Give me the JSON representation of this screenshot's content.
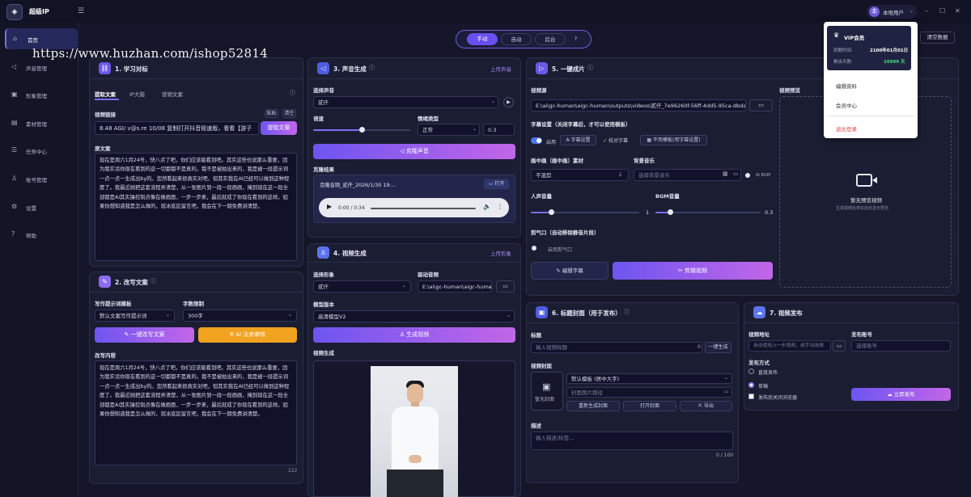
{
  "app": {
    "title": "超级IP",
    "user": "本地用户",
    "avatar": "本"
  },
  "window": {
    "minimize": "–",
    "maximize": "☐",
    "close": "✕",
    "menu": "☰"
  },
  "sidebar": {
    "items": [
      {
        "label": "首页",
        "icon": "⌂"
      },
      {
        "label": "声音管理",
        "icon": "◁"
      },
      {
        "label": "形象管理",
        "icon": "▣"
      },
      {
        "label": "素材管理",
        "icon": "▤"
      },
      {
        "label": "任务中心",
        "icon": "☰"
      },
      {
        "label": "账号管理",
        "icon": "♙"
      },
      {
        "label": "设置",
        "icon": "⚙"
      },
      {
        "label": "帮助",
        "icon": "?"
      }
    ]
  },
  "mode": {
    "manual": "手动",
    "auto": "自动",
    "background": "后台",
    "help": "?"
  },
  "clear_data": "清空数据",
  "watermark": "https://www.huzhan.com/ishop52814",
  "dropdown": {
    "vip": "VIP会员",
    "expire_label": "到期时间:",
    "expire_value": "2100年01月01日",
    "remain_label": "剩余天数:",
    "remain_value": "26999 天",
    "edit_profile": "编辑资料",
    "member_center": "会员中心",
    "logout": "退出登录"
  },
  "p1": {
    "num": "1.",
    "title": "学习对标",
    "tabs": [
      "提取文案",
      "IP大脑",
      "营销文案"
    ],
    "link_label": "视频链接",
    "paste": "粘贴",
    "clear": "清空",
    "link_value": "8.48 AGI/ v@s.re 10/08 复制打开抖音极速版，看看【游子",
    "extract": "提取文案",
    "orig_label": "原文案",
    "orig_text": "现在是周六1月24号，快八点了吧，你们应该能看到吧。其实这些也说那么重要，因为我实话你现在看到的这一切都都不是真的。我不是被拍出来的，我是被一段提示词一点一点一生成出by的。您然看起来很真实对吧，但其实我在AI已经可以做到这种程度了。我最近刚把这套流程弄清楚，从一张图片到一段一段画画，掩到现在这一段全部都是AI其实操控制点像在做画面，一步一步来，最后就成了你现在看到的这样。如果你想知道我是怎么做的，就冰底区留言吧，我会在下一期免费讲清楚。"
  },
  "p2": {
    "num": "2.",
    "title": "改写文案",
    "tpl_label": "写作提示词模板",
    "tpl_value": "默认文案写作提示词",
    "words_label": "字数限制",
    "words_value": "300字",
    "rewrite_btn": "一键改写文案",
    "ai_btn": "AI 法务审核",
    "result_label": "改写内容",
    "result_text": "现在是周六1月24号，快八点了吧，你们应该能看到吧。其实这些也说那么重要，因为我实话你现在看到的这一切都都不是真的。我不是被拍出来的，我是被一段提示词一点一点一生成出by的。您然看起来很真实对吧，但其实我在AI已经可以做到这种程度了。我最近刚把这套流程弄清楚，从一张图片到一段一段画画，掩到现在这一段全部都是AI其实操控制点像在做画面，一步一步来，最后就成了你现在看到的这样。如果你想知道我是怎么做的，就冰底区留言吧，我会在下一期免费讲清楚。",
    "count": "222"
  },
  "p3": {
    "num": "3.",
    "title": "声音生成",
    "upload": "上传声音",
    "voice_label": "选择声音",
    "voice_value": "贰仟",
    "speed_label": "语速",
    "emotion_label": "情绪类型",
    "emotion_value": "正常",
    "emotion_num": "0.3",
    "clone_btn": "克隆声音",
    "result_label": "克隆结果",
    "audio_name": "克隆音频_贰仟_2026/1/30 19:...",
    "open": "打开",
    "time": "0:00 / 0:34"
  },
  "p4": {
    "num": "4.",
    "title": "视频生成",
    "upload": "上传形象",
    "avatar_label": "选择形象",
    "avatar_value": "贰仟",
    "audio_label": "驱动音频",
    "audio_value": "E:\\ai\\gc-human\\aigc-human",
    "model_label": "模型版本",
    "model_value": "高清模型V2",
    "gen_btn": "生成视频",
    "result_label": "视频生成"
  },
  "p5": {
    "num": "5.",
    "title": "一键成片",
    "src_label": "视频源",
    "src_value": "E:\\ai\\gc-human\\aigc-human\\outputs\\videos\\贰仟_7e96260f-56ff-4dd5-95ca-dbda6ea6",
    "subtitle_label": "字幕设置（关闭字幕后，才可以使用模板）",
    "enable": "启用",
    "sub_settings": "字幕设置",
    "proofread": "校对字幕",
    "no_template": "不用模板(用字幕设置)",
    "pip_label": "画中画（画中画）素材",
    "pip_value": "不混剪",
    "bgm_label": "背景音乐",
    "bgm_placeholder": "选择背景音乐",
    "ai_bgm": "AI BGM",
    "voice_vol_label": "人声音量",
    "voice_vol": "1",
    "bgm_vol_label": "BGM音量",
    "bgm_vol": "0.3",
    "breath_label": "剪气口（自动移除静音片段）",
    "breath_toggle": "启用剪气口",
    "edit_sub": "编辑字幕",
    "cut_btn": "剪辑视频",
    "preview_label": "视频预览",
    "no_preview": "暂无预览视频",
    "no_preview_hint": "生成视频后将在此处显示预览"
  },
  "p6": {
    "num": "6.",
    "title": "标题封面（用于发布）",
    "title_label": "标题",
    "title_placeholder": "输入视频标题",
    "title_count": "0",
    "one_click": "一键生成",
    "cover_label": "视频封面",
    "cover_tpl": "默认模板 (居中大字)",
    "cover_path": "封面图片路径",
    "no_cover": "暂无封面",
    "regen": "重新生成封面",
    "open_cover": "打开封面",
    "export": "导出",
    "desc_label": "描述",
    "desc_placeholder": "输入描述/标签...",
    "desc_count": "0 / 100"
  },
  "p7": {
    "num": "7.",
    "title": "视频发布",
    "addr_label": "视频地址",
    "addr_placeholder": "自动使用上一步视频，或手动选择",
    "account_label": "发布账号",
    "account_placeholder": "选择账号",
    "method_label": "发布方式",
    "direct": "直接发布",
    "draft": "草稿",
    "close_browser": "发布后关闭浏览器",
    "publish_btn": "立即发布"
  }
}
